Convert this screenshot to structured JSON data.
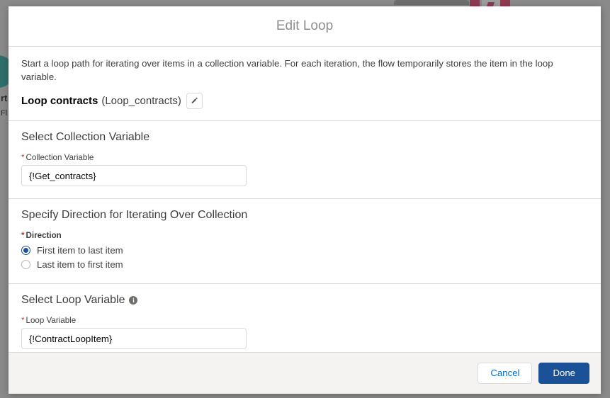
{
  "background": {
    "text_fragments": [
      "rt",
      "Fl"
    ]
  },
  "modal": {
    "title": "Edit Loop",
    "description": "Start a loop path for iterating over items in a collection variable. For each iteration, the flow temporarily stores the item in the loop variable.",
    "element_label": "Loop contracts",
    "element_api_name": "(Loop_contracts)",
    "edit_icon": "pencil-icon",
    "sections": [
      {
        "title": "Select Collection Variable",
        "field_label": "Collection Variable",
        "required_marker": "*",
        "field_value": "{!Get_contracts}",
        "field_placeholder": ""
      },
      {
        "title": "Specify Direction for Iterating Over Collection",
        "field_label": "Direction",
        "required_marker": "*",
        "options": [
          {
            "label": "First item to last item",
            "selected": true
          },
          {
            "label": "Last item to first item",
            "selected": false
          }
        ]
      },
      {
        "title": "Select Loop Variable",
        "info_icon": "info-icon",
        "info_glyph": "i",
        "field_label": "Loop Variable",
        "required_marker": "*",
        "field_value": "{!ContractLoopItem}",
        "field_placeholder": ""
      }
    ],
    "footer": {
      "cancel_label": "Cancel",
      "done_label": "Done"
    }
  },
  "colors": {
    "brand_blue": "#1b5297",
    "link_blue": "#0070d2",
    "required_red": "#c23934",
    "border_gray": "#dddbda",
    "footer_gray": "#f4f3f2",
    "backdrop_gray": "#8a8a8a",
    "teal": "#2f6f6b",
    "maroon": "#8d3a52"
  }
}
